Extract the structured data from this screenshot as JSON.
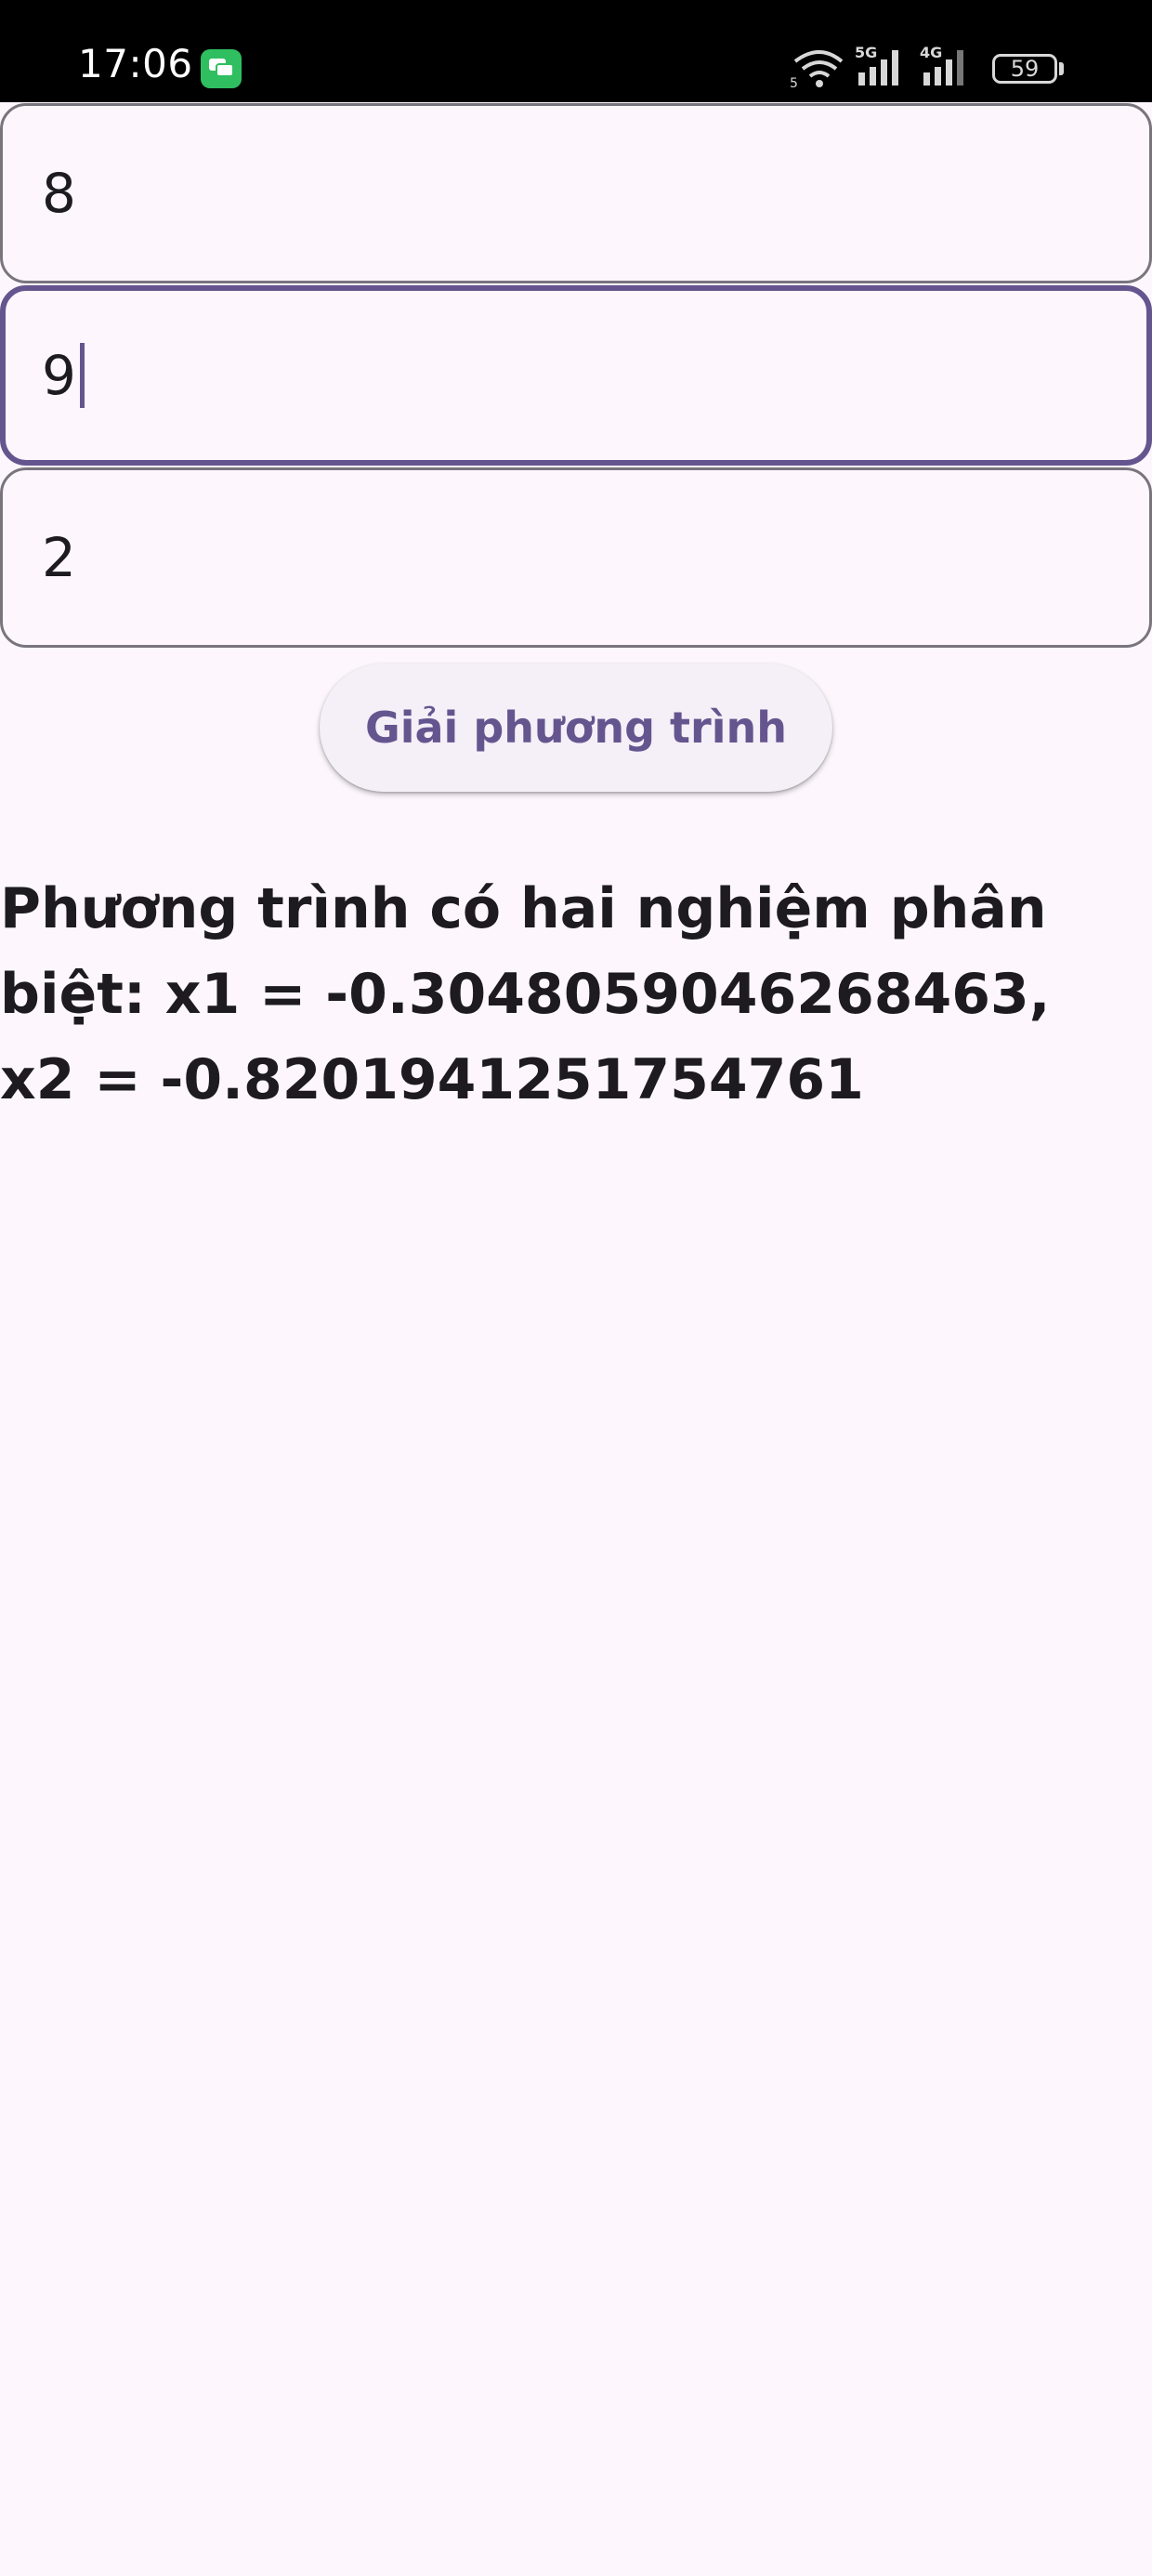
{
  "status_bar": {
    "time": "17:06",
    "battery_level": "59",
    "icons": [
      "messages-app-icon",
      "wifi-icon",
      "signal-5g-icon",
      "signal-4g-icon",
      "battery-icon"
    ]
  },
  "form": {
    "coefficient_a": "8",
    "coefficient_b": "9",
    "coefficient_c": "2"
  },
  "solve_button": {
    "label": "Giải phương trình"
  },
  "result": {
    "text": "Phương trình có hai nghiệm phân biệt: x1 = -0.3048059046268463, x2 = -0.8201941251754761"
  },
  "colors": {
    "background": "#fdf7fd",
    "accent": "#65558f",
    "field_border": "#79747e",
    "button_bg": "#f5eff7",
    "text": "#1d1b20"
  }
}
